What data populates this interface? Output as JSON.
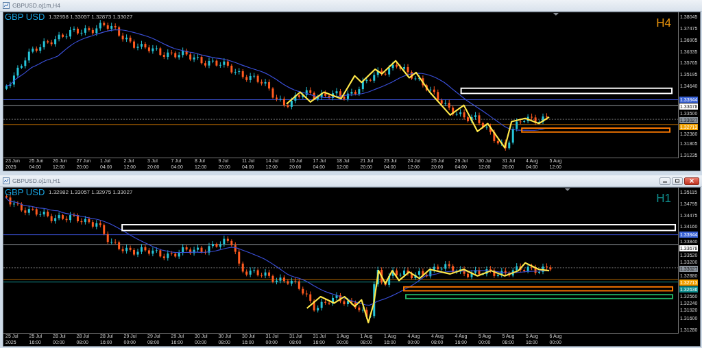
{
  "windows": [
    {
      "title": "GBPUSD.oj1m,H4",
      "controls": false,
      "symbol_label": "GBP USD",
      "quote_line": "1.32958 1.33057 1.32873 1.33027",
      "timeframe_label": "H4",
      "price_ticks": [
        "1.38045",
        "1.37475",
        "1.36905",
        "1.36335",
        "1.35765",
        "1.35195",
        "1.34640",
        "1.33500",
        "1.32360",
        "1.31805",
        "1.31235"
      ],
      "price_tags": [
        {
          "text": "1.33944",
          "color": "#3a63d6"
        },
        {
          "text": "1.33678",
          "color": "#ffffff"
        },
        {
          "text": "1.33027",
          "color": "#8a939c"
        },
        {
          "text": "1.32713",
          "color": "#f0a000"
        }
      ],
      "zones": [
        {
          "color": "#ffffff"
        },
        {
          "color": "#ff7a00"
        }
      ],
      "time_labels": [
        "23 Jun 2025",
        "25 Jun 04:00",
        "26 Jun 12:00",
        "27 Jun 20:00",
        "1 Jul 04:00",
        "2 Jul 12:00",
        "3 Jul 20:00",
        "7 Jul 04:00",
        "8 Jul 12:00",
        "9 Jul 20:00",
        "11 Jul 04:00",
        "14 Jul 12:00",
        "15 Jul 20:00",
        "17 Jul 04:00",
        "18 Jul 12:00",
        "21 Jul 20:00",
        "23 Jul 04:00",
        "24 Jul 12:00",
        "25 Jul 20:00",
        "29 Jul 04:00",
        "30 Jul 12:00",
        "31 Jul 20:00",
        "4 Aug 04:00",
        "5 Aug 12:00"
      ]
    },
    {
      "title": "GBPUSD.oj1m,H1",
      "controls": true,
      "symbol_label": "GBP USD",
      "quote_line": "1.32982 1.33057 1.32975 1.33027",
      "timeframe_label": "H1",
      "price_ticks": [
        "1.35115",
        "1.34795",
        "1.34475",
        "1.34160",
        "1.33840",
        "1.33520",
        "1.33200",
        "1.32880",
        "1.32560",
        "1.32240",
        "1.31920",
        "1.31600",
        "1.31280"
      ],
      "price_tags": [
        {
          "text": "1.33944",
          "color": "#3a63d6"
        },
        {
          "text": "1.33678",
          "color": "#ffffff"
        },
        {
          "text": "1.33027",
          "color": "#8a939c"
        },
        {
          "text": "1.32713",
          "color": "#f0a000"
        },
        {
          "text": "1.32636",
          "color": "#0f8f8f"
        }
      ],
      "zones": [
        {
          "color": "#ffffff"
        },
        {
          "color": "#ff7a00"
        },
        {
          "color": "#22b060"
        }
      ],
      "time_labels": [
        "25 Jul 2025",
        "25 Jul 16:00",
        "28 Jul 00:00",
        "28 Jul 08:00",
        "28 Jul 16:00",
        "29 Jul 00:00",
        "29 Jul 08:00",
        "29 Jul 16:00",
        "30 Jul 00:00",
        "30 Jul 08:00",
        "30 Jul 16:00",
        "31 Jul 00:00",
        "31 Jul 08:00",
        "31 Jul 16:00",
        "1 Aug 00:00",
        "1 Aug 08:00",
        "1 Aug 16:00",
        "4 Aug 00:00",
        "4 Aug 08:00",
        "4 Aug 16:00",
        "5 Aug 00:00",
        "5 Aug 08:00",
        "5 Aug 16:00",
        "6 Aug 00:00"
      ]
    }
  ]
}
